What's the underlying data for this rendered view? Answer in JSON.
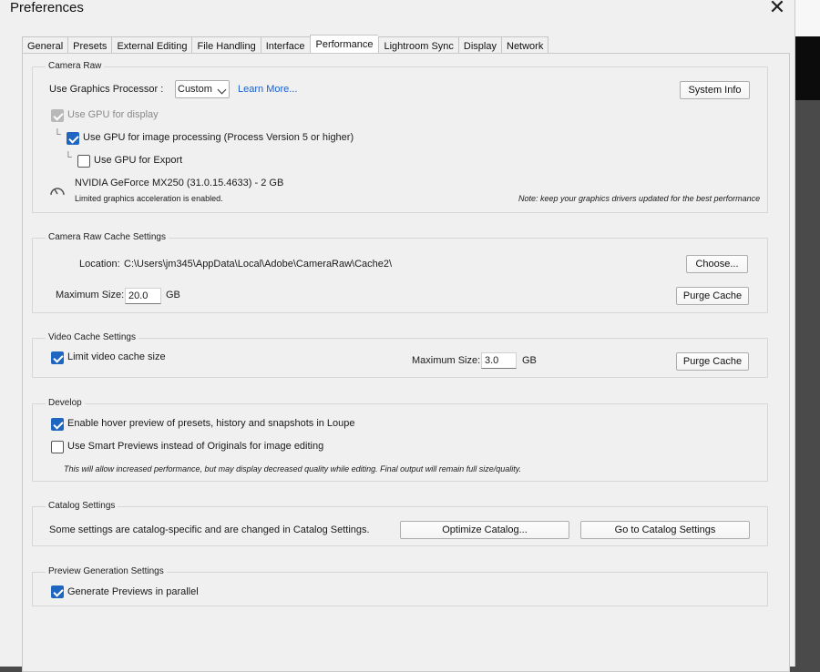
{
  "window": {
    "title": "Preferences"
  },
  "tabs": [
    "General",
    "Presets",
    "External Editing",
    "File Handling",
    "Interface",
    "Performance",
    "Lightroom Sync",
    "Display",
    "Network"
  ],
  "camera_raw": {
    "group_label": "Camera Raw",
    "use_gpu_label": "Use Graphics Processor :",
    "gpu_select_value": "Custom",
    "learn_more": "Learn More...",
    "system_info_button": "System Info",
    "use_gpu_display": "Use GPU for display",
    "use_gpu_processing": "Use GPU for image processing (Process Version 5 or higher)",
    "use_gpu_export": "Use GPU for Export",
    "gpu_name": "NVIDIA GeForce MX250 (31.0.15.4633) - 2 GB",
    "accel_status": "Limited graphics acceleration is enabled.",
    "driver_note": "Note: keep your graphics drivers updated for the best performance"
  },
  "cache": {
    "group_label": "Camera Raw Cache Settings",
    "location_label": "Location:",
    "location_path": "C:\\Users\\jm345\\AppData\\Local\\Adobe\\CameraRaw\\Cache2\\",
    "choose_button": "Choose...",
    "max_size_label": "Maximum Size:",
    "max_size_value": "20.0",
    "unit": "GB",
    "purge_button": "Purge Cache"
  },
  "video_cache": {
    "group_label": "Video Cache Settings",
    "limit_label": "Limit video cache size",
    "max_size_label": "Maximum Size:",
    "max_size_value": "3.0",
    "unit": "GB",
    "purge_button": "Purge Cache"
  },
  "develop": {
    "group_label": "Develop",
    "hover_preview_label": "Enable hover preview of presets, history and snapshots in Loupe",
    "smart_previews_label": "Use Smart Previews instead of Originals for image editing",
    "smart_previews_note": "This will allow increased performance, but may display decreased quality while editing. Final output will remain full size/quality."
  },
  "catalog": {
    "group_label": "Catalog Settings",
    "note": "Some settings are catalog-specific and are changed in Catalog Settings.",
    "optimize_button": "Optimize Catalog...",
    "goto_button": "Go to Catalog Settings"
  },
  "preview": {
    "group_label": "Preview Generation Settings",
    "parallel_label": "Generate Previews in parallel"
  },
  "state": {
    "use_gpu_display_checked": true,
    "use_gpu_processing_checked": true,
    "use_gpu_export_checked": false,
    "limit_video_cache_checked": true,
    "hover_preview_checked": true,
    "smart_previews_checked": false,
    "generate_parallel_checked": true
  }
}
